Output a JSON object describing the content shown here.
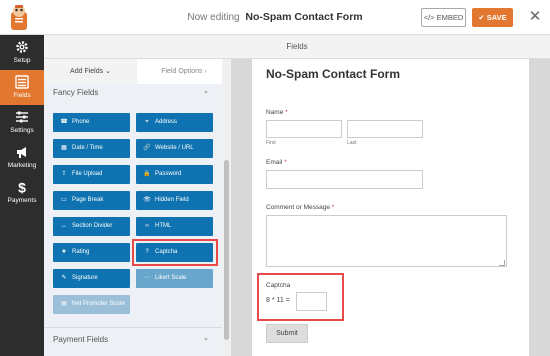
{
  "topbar": {
    "editing_prefix": "Now editing",
    "form_name": "No-Spam Contact Form",
    "embed_label": "</> EMBED",
    "save_label": "✔ SAVE",
    "close_glyph": "✕",
    "accent_color": "#e27730"
  },
  "leftnav": {
    "items": [
      {
        "label": "Setup",
        "icon": "gear-icon"
      },
      {
        "label": "Fields",
        "icon": "fields-icon"
      },
      {
        "label": "Settings",
        "icon": "sliders-icon"
      },
      {
        "label": "Marketing",
        "icon": "megaphone-icon"
      },
      {
        "label": "Payments",
        "icon": "dollar-icon"
      }
    ]
  },
  "header": {
    "title": "Fields"
  },
  "panel": {
    "tab_add": "Add Fields",
    "tab_add_chevron": "⌄",
    "tab_options": "Field Options",
    "tab_options_chevron": "›",
    "fancy_title": "Fancy Fields",
    "fancy_chevron": "⌄",
    "fields": [
      {
        "label": "Phone",
        "icon": "☎"
      },
      {
        "label": "Address",
        "icon": "⌖"
      },
      {
        "label": "Date / Time",
        "icon": "▦"
      },
      {
        "label": "Website / URL",
        "icon": "🔗"
      },
      {
        "label": "File Upload",
        "icon": "⇪"
      },
      {
        "label": "Password",
        "icon": "🔒"
      },
      {
        "label": "Page Break",
        "icon": "▭"
      },
      {
        "label": "Hidden Field",
        "icon": "👁"
      },
      {
        "label": "Section Divider",
        "icon": "↔"
      },
      {
        "label": "HTML",
        "icon": "‹›"
      },
      {
        "label": "Rating",
        "icon": "★"
      },
      {
        "label": "Captcha",
        "icon": "?"
      },
      {
        "label": "Signature",
        "icon": "✎"
      },
      {
        "label": "Likert Scale",
        "icon": "⋯"
      },
      {
        "label": "Net Promoter Score",
        "icon": "▤"
      }
    ],
    "payment_title": "Payment Fields",
    "payment_chevron": "⌄"
  },
  "form": {
    "title": "No-Spam Contact Form",
    "name_label": "Name",
    "required_mark": "*",
    "first_label": "First",
    "last_label": "Last",
    "email_label": "Email",
    "comment_label": "Comment or Message",
    "captcha_label": "Captcha",
    "captcha_question": "8 * 11 =",
    "submit_label": "Submit"
  }
}
